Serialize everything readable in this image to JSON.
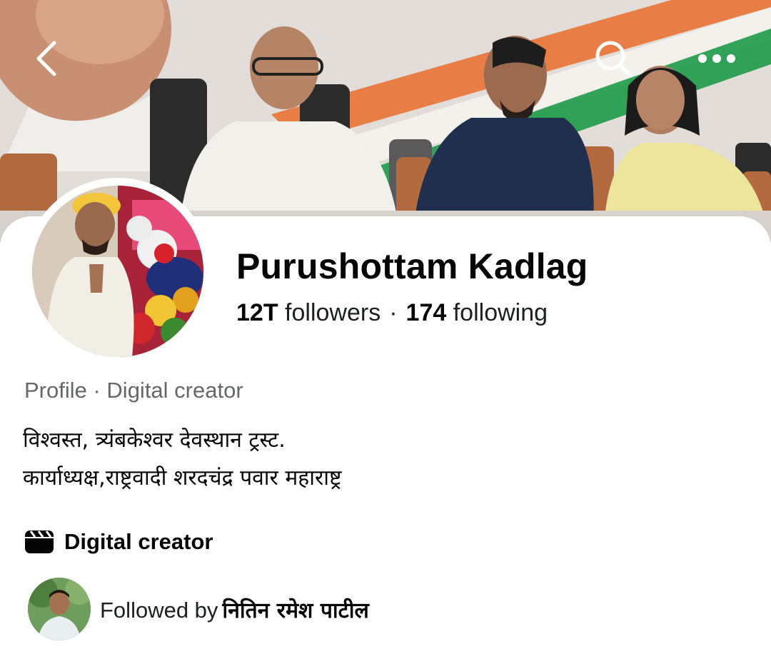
{
  "profile": {
    "name": "Purushottam Kadlag",
    "followers_count": "12T",
    "followers_label": "followers",
    "separator": "·",
    "following_count": "174",
    "following_label": "following",
    "category_line": "Profile · Digital creator",
    "bio_lines": [
      "विश्वस्त, त्र्यंबकेश्वर देवस्थान ट्रस्ट.",
      "कार्याध्यक्ष,राष्ट्रवादी शरदचंद्र पवार महाराष्ट्र"
    ],
    "creator_label": "Digital creator",
    "followed_by_prefix": "Followed by",
    "followed_by_name": "नितिन रमेश पाटील"
  },
  "icons": {
    "back": "chevron-left-icon",
    "search": "search-icon",
    "more": "more-horizontal-icon",
    "creator": "clapperboard-icon"
  },
  "colors": {
    "text_primary": "#050505",
    "text_secondary": "#65676b",
    "nav_icon": "#ffffff",
    "flag_saffron": "#e8753a",
    "flag_green": "#1f9a4a"
  }
}
